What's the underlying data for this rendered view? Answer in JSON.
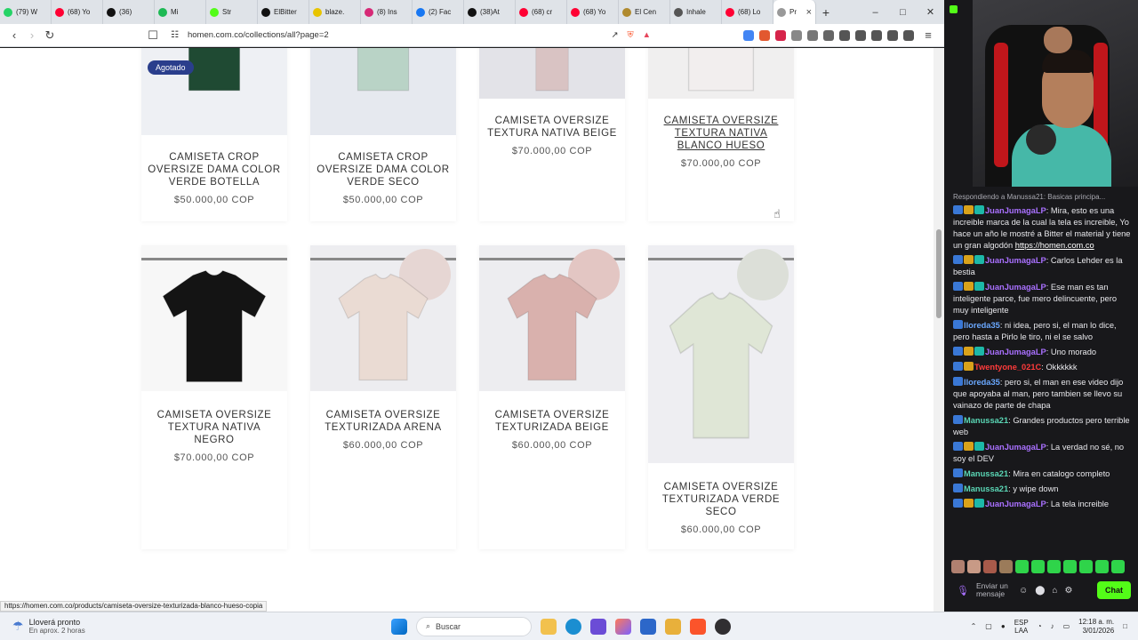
{
  "browser": {
    "tabs": [
      {
        "label": "(79) W",
        "color": "#25d366"
      },
      {
        "label": "(68) Yo",
        "color": "#ff0033"
      },
      {
        "label": "(36)",
        "color": "#111111"
      },
      {
        "label": "Mi",
        "color": "#1db954"
      },
      {
        "label": "Str",
        "color": "#53fc18"
      },
      {
        "label": "ElBitter",
        "color": "#111111"
      },
      {
        "label": "blaze.",
        "color": "#e8c400"
      },
      {
        "label": "(8) Ins",
        "color": "#d62976"
      },
      {
        "label": "(2) Fac",
        "color": "#1877f2"
      },
      {
        "label": "(38)At",
        "color": "#111111"
      },
      {
        "label": "(68) cr",
        "color": "#ff0033"
      },
      {
        "label": "(68) Yo",
        "color": "#ff0033"
      },
      {
        "label": "El Cen",
        "color": "#b08a2e"
      },
      {
        "label": "Inhale",
        "color": "#555555"
      },
      {
        "label": "(68) Lo",
        "color": "#ff0033"
      }
    ],
    "active_tab": {
      "label": "Pr",
      "color": "#999999"
    },
    "new_tab": "+",
    "url": "homen.com.co/collections/all?page=2",
    "status_url": "https://homen.com.co/products/camiseta-oversize-texturizada-blanco-hueso-copia"
  },
  "store": {
    "products_row1": [
      {
        "name": "CAMISETA CROP OVERSIZE DAMA COLOR VERDE BOTELLA",
        "price": "$50.000,00 COP",
        "badge": "Agotado",
        "shirt_color": "#1f4a33"
      },
      {
        "name": "CAMISETA CROP OVERSIZE DAMA COLOR VERDE SECO",
        "price": "$50.000,00 COP",
        "shirt_color": "#b9d3c6"
      },
      {
        "name": "CAMISETA OVERSIZE TEXTURA NATIVA BEIGE",
        "price": "$70.000,00 COP",
        "shirt_color": "#d9c3c3"
      },
      {
        "name": "CAMISETA OVERSIZE TEXTURA NATIVA BLANCO HUESO",
        "price": "$70.000,00 COP",
        "shirt_color": "#f2eeee"
      }
    ],
    "products_row2": [
      {
        "name": "CAMISETA OVERSIZE TEXTURA NATIVA NEGRO",
        "price": "$70.000,00 COP",
        "shirt_color": "#141414"
      },
      {
        "name": "CAMISETA OVERSIZE TEXTURIZADA ARENA",
        "price": "$60.000,00 COP",
        "shirt_color": "#eadbd3"
      },
      {
        "name": "CAMISETA OVERSIZE TEXTURIZADA BEIGE",
        "price": "$60.000,00 COP",
        "shirt_color": "#d9b1ad"
      },
      {
        "name": "CAMISETA OVERSIZE TEXTURIZADA VERDE SECO",
        "price": "$60.000,00 COP",
        "shirt_color": "#dfe6d6"
      }
    ]
  },
  "chat": {
    "reply_note": "Respondiendo a Manussa21: Basicas principa...",
    "messages": [
      {
        "user": "JuanJumagaLP",
        "user_color": "#a970ff",
        "text": "Mira, esto es una increible marca de la cual la tela es increible, Yo hace un año le mostré a Bitter el material y tiene un gran algodón ",
        "link": "https://homen.com.co",
        "badges": 3
      },
      {
        "user": "JuanJumagaLP",
        "user_color": "#a970ff",
        "text": "Carlos Lehder es la bestia",
        "badges": 3
      },
      {
        "user": "JuanJumagaLP",
        "user_color": "#a970ff",
        "text": "Ese man es tan inteligente parce, fue mero delincuente, pero muy inteligente",
        "badges": 3
      },
      {
        "user": "lloreda35",
        "user_color": "#6aa8ff",
        "text": "ni idea, pero si, el man lo dice, pero hasta a Pirlo le tiro, ni el se salvo",
        "badges": 1
      },
      {
        "user": "JuanJumagaLP",
        "user_color": "#a970ff",
        "text": "Uno morado",
        "badges": 3
      },
      {
        "user": "Twentyone_021C",
        "user_color": "#ff3b3b",
        "text": "Okkkkkk",
        "badges": 2
      },
      {
        "user": "lloreda35",
        "user_color": "#6aa8ff",
        "text": "pero si, el man en ese video dijo que apoyaba al man, pero tambien se llevo su vainazo de parte de chapa",
        "badges": 1
      },
      {
        "user": "Manussa21",
        "user_color": "#5ad6b5",
        "text": "Grandes productos pero terrible web",
        "badges": 1
      },
      {
        "user": "JuanJumagaLP",
        "user_color": "#a970ff",
        "text": "La verdad no sé, no soy el DEV",
        "badges": 3
      },
      {
        "user": "Manussa21",
        "user_color": "#5ad6b5",
        "text": "Mira en catalogo completo",
        "badges": 1
      },
      {
        "user": "Manussa21",
        "user_color": "#5ad6b5",
        "text": "y wipe down",
        "badges": 1
      },
      {
        "user": "JuanJumagaLP",
        "user_color": "#a970ff",
        "text": "La tela increible",
        "badges": 3
      }
    ],
    "input_placeholder": "Enviar un mensaje",
    "chat_button": "Chat"
  },
  "taskbar": {
    "weather_title": "Lloverá pronto",
    "weather_sub": "En aprox. 2 horas",
    "search_placeholder": "Buscar",
    "lang_top": "ESP",
    "lang_bottom": "LAA",
    "time": "12:18 a. m.",
    "date": "3/01/2026"
  }
}
